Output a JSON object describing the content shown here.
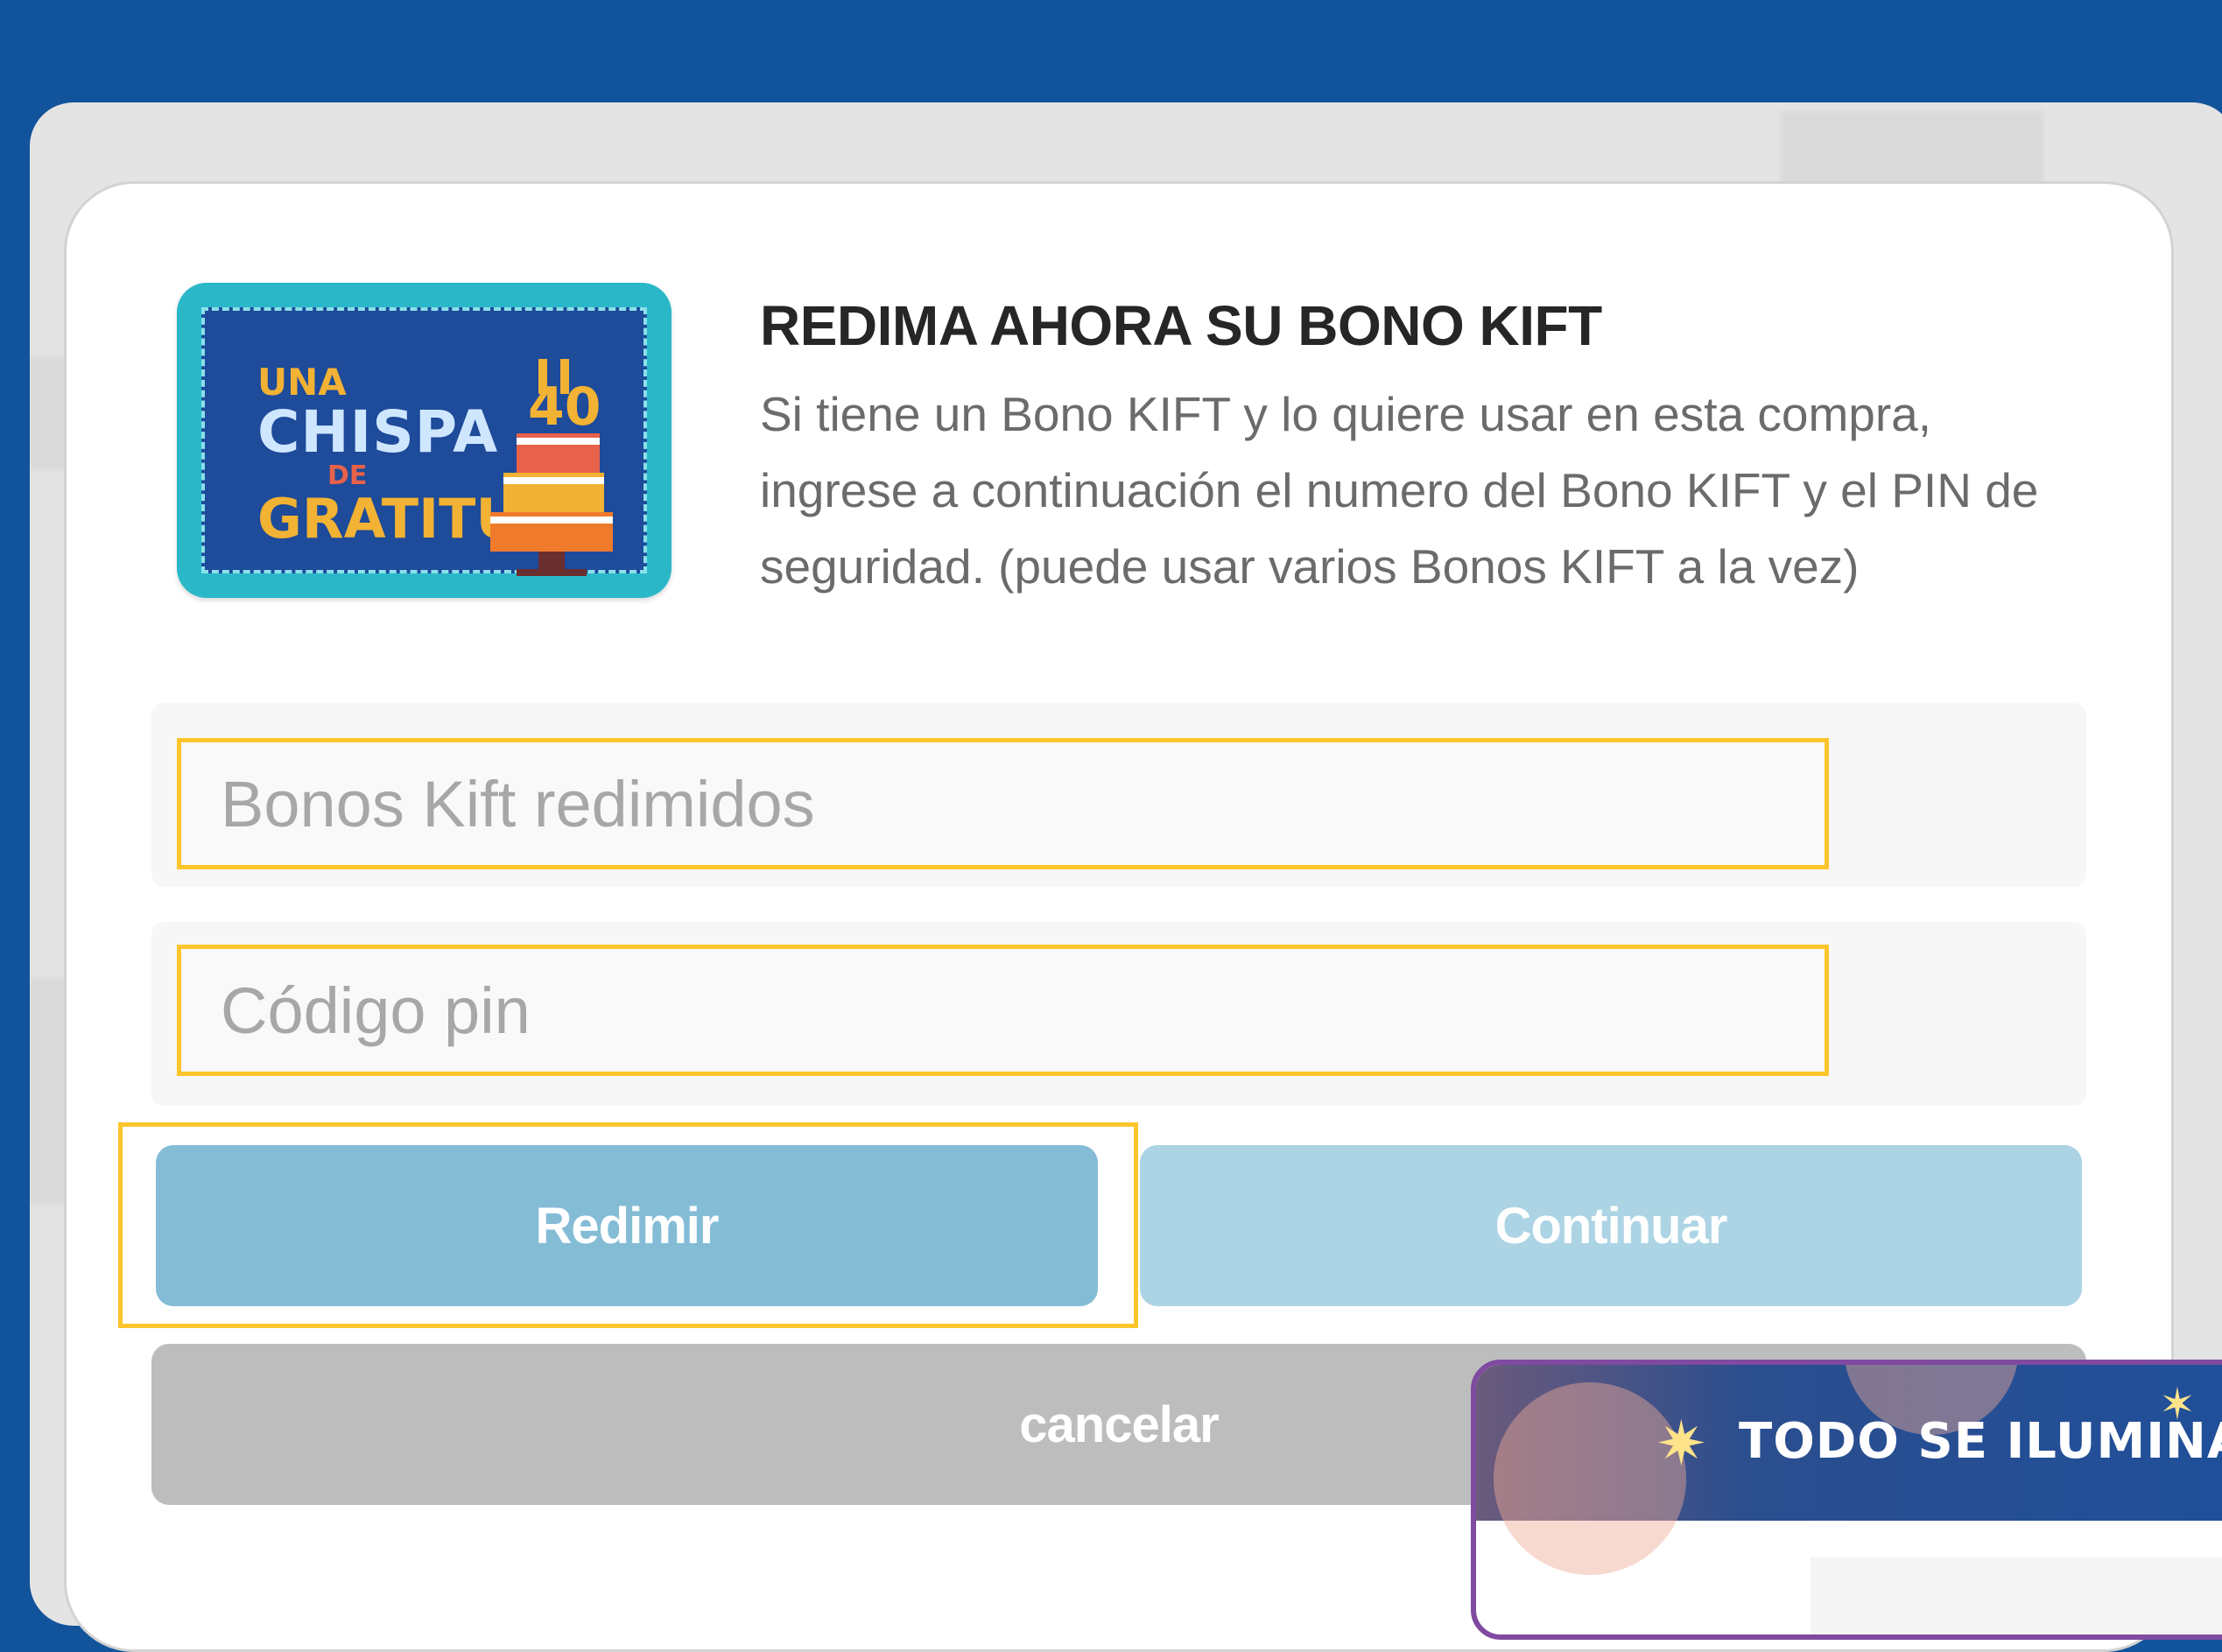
{
  "modal": {
    "title": "REDIMA AHORA SU BONO KIFT",
    "description": "Si tiene un Bono KIFT y lo quiere usar en esta compra, ingrese a continuación el numero del Bono KIFT y el PIN de seguridad. (puede usar varios Bonos KIFT a la vez)",
    "gift_card": {
      "line1": "UNA",
      "line2": "CHISPA",
      "line3": "DE",
      "line4": "GRATITUD",
      "cake_number": "40"
    },
    "bono_field": {
      "placeholder": "Bonos Kift redimidos",
      "value": ""
    },
    "pin_field": {
      "placeholder": "Código pin",
      "value": ""
    },
    "buttons": {
      "redimir": "Redimir",
      "continuar": "Continuar",
      "cancelar": "cancelar"
    }
  },
  "promo": {
    "title": "TODO SE ILUMINA C"
  },
  "colors": {
    "background": "#11549b",
    "highlight": "#fbc52b",
    "redimir_button": "#84bcd6",
    "continuar_button": "#acd4e4",
    "cancelar_button": "#bdbdbd",
    "promo_border": "#7f4aa0"
  },
  "icons": [
    "sparkle-icon",
    "cake-icon"
  ]
}
